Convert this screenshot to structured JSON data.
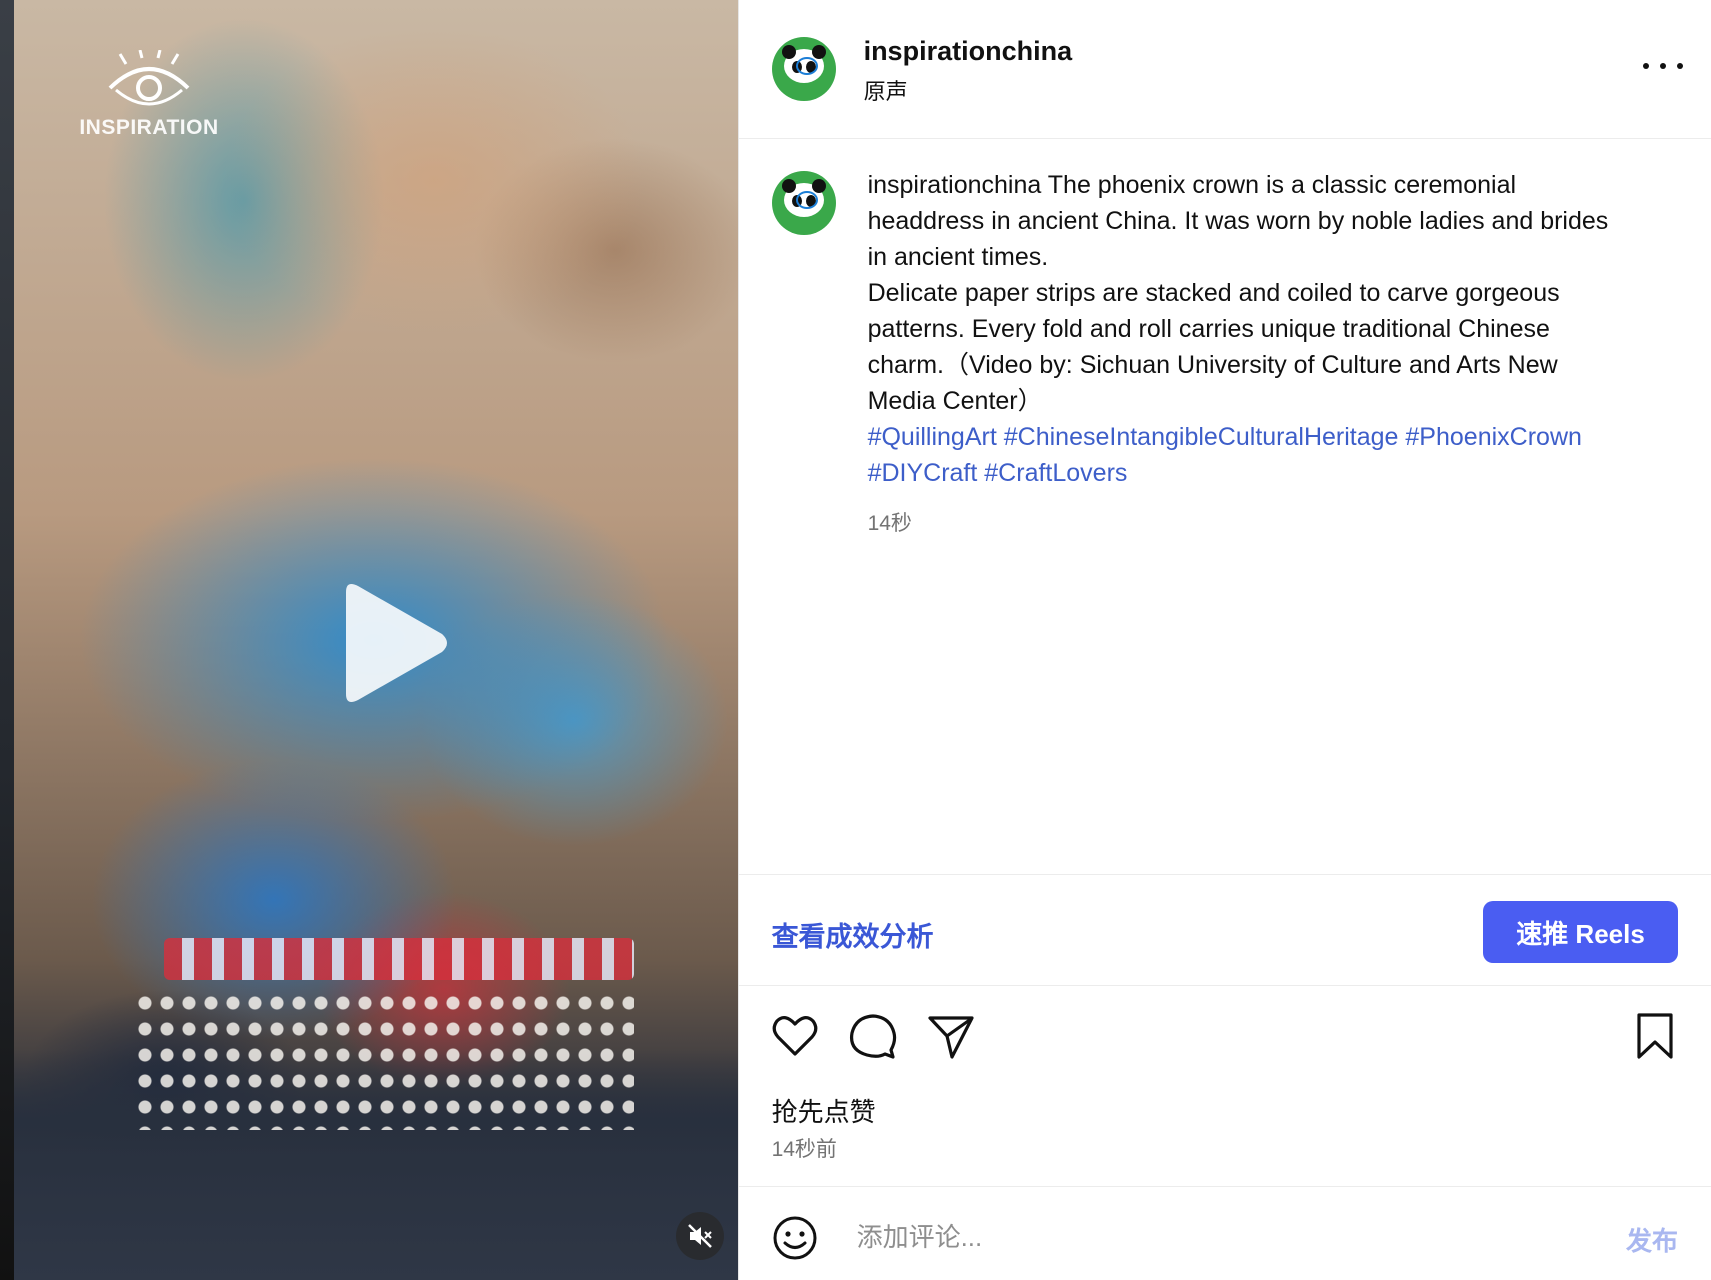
{
  "media": {
    "watermark_text": "INSPIRATION",
    "play_icon": "play-icon",
    "mute_icon": "volume-muted-icon"
  },
  "header": {
    "username": "inspirationchina",
    "audio_label": "原声",
    "more_icon": "more-horizontal-icon"
  },
  "caption": {
    "username": "inspirationchina",
    "paragraph_1": " The phoenix crown is a classic ceremonial headdress in ancient China. It was worn by noble ladies and brides in ancient times.",
    "paragraph_2": "Delicate paper strips are stacked and coiled to carve gorgeous patterns. Every fold and roll carries unique traditional Chinese charm.（Video by: Sichuan University of Culture and Arts New Media Center）",
    "hashtags": [
      "#QuillingArt",
      "#ChineseIntangibleCulturalHeritage",
      "#PhoenixCrown",
      "#DIYCraft",
      "#CraftLovers"
    ],
    "time": "14秒"
  },
  "insights": {
    "view_label": "查看成效分析",
    "boost_label": "速推 Reels"
  },
  "actions": {
    "like_icon": "heart-icon",
    "comment_icon": "comment-icon",
    "share_icon": "send-icon",
    "save_icon": "bookmark-icon",
    "likes_text": "抢先点赞",
    "post_time": "14秒前"
  },
  "comment_bar": {
    "emoji_icon": "emoji-icon",
    "placeholder": "添加评论...",
    "post_label": "发布"
  },
  "colors": {
    "link_blue": "#3d5ec9",
    "button_blue": "#4a5df2",
    "post_disabled": "#a9b7f0",
    "muted_text": "#737373"
  }
}
